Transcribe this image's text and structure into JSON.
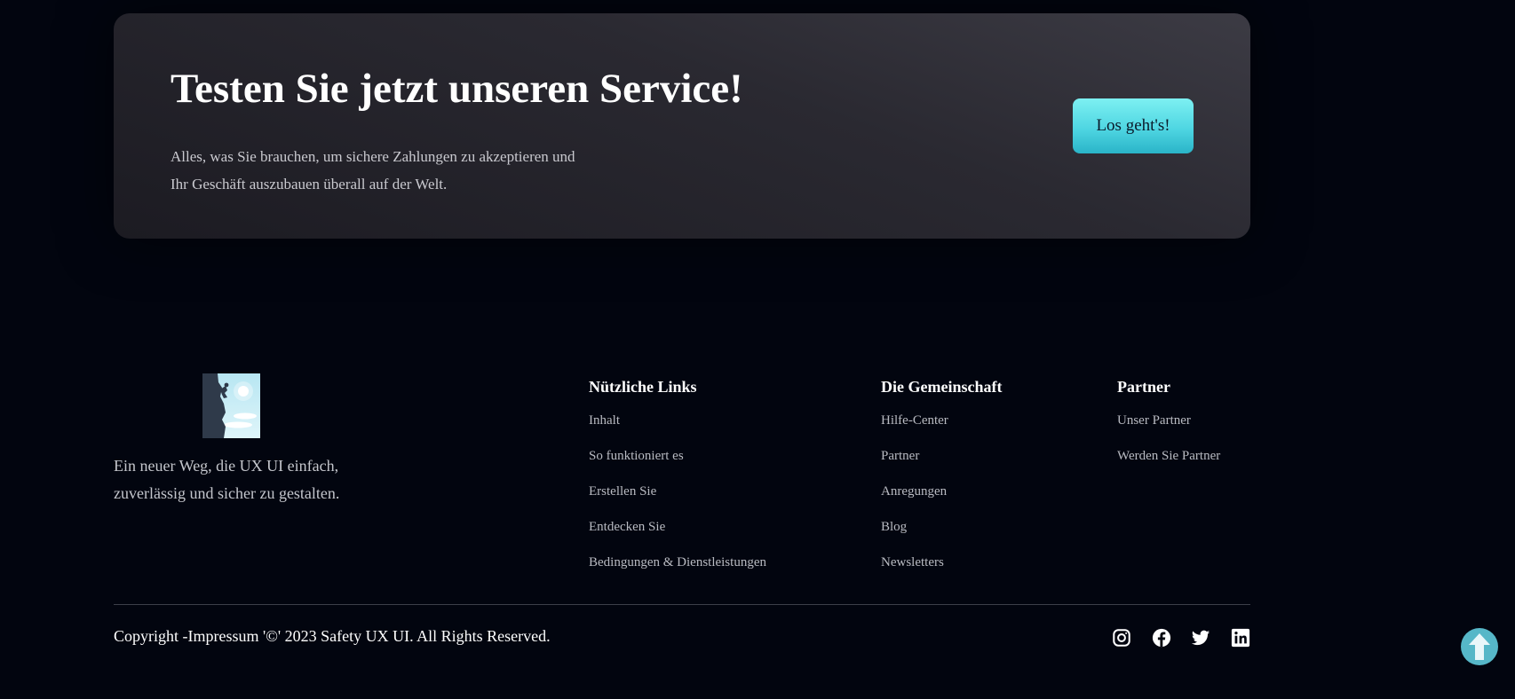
{
  "cta": {
    "title": "Testen Sie jetzt unseren Service!",
    "text": "Alles, was Sie brauchen, um sichere Zahlungen zu akzeptieren und Ihr Geschäft auszubauen überall auf der Welt.",
    "button_label": "Los geht's!"
  },
  "footer": {
    "tagline": "Ein neuer Weg, die UX UI einfach, zuverlässig und sicher zu gestalten.",
    "columns": [
      {
        "heading": "Nützliche Links",
        "links": [
          "Inhalt",
          "So funktioniert es",
          "Erstellen Sie",
          "Entdecken Sie",
          "Bedingungen & Dienstleistungen"
        ]
      },
      {
        "heading": "Die Gemeinschaft",
        "links": [
          "Hilfe-Center",
          "Partner",
          "Anregungen",
          "Blog",
          "Newsletters"
        ]
      },
      {
        "heading": "Partner",
        "links": [
          "Unser Partner",
          "Werden Sie Partner"
        ]
      }
    ],
    "copyright": "Copyright -Impressum '©' 2023 Safety UX UI. All Rights Reserved.",
    "social_icons": [
      "instagram-icon",
      "facebook-icon",
      "twitter-icon",
      "linkedin-icon"
    ]
  },
  "colors": {
    "background": "#02050f",
    "accent": "#4fd6e2",
    "scroll_top": "#56b7c8"
  }
}
